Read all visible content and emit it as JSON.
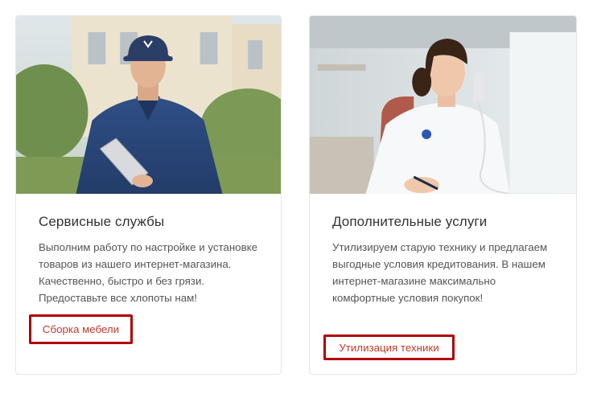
{
  "cards": [
    {
      "image": "worker-with-laptop-photo",
      "title": "Сервисные службы",
      "description": "Выполним работу по настройке и установке товаров из нашего интернет-магазина. Качественно, быстро и без грязи. Предоставьте все хлопоты нам!",
      "link": "Сборка мебели"
    },
    {
      "image": "operator-on-phone-photo",
      "title": "Дополнительные услуги",
      "description": "Утилизируем старую технику и предлагаем выгодные условия кредитования. В нашем интернет-магазине максимально комфортные условия покупок!",
      "link": "Утилизация техники"
    }
  ],
  "colors": {
    "link": "#c0392b",
    "highlight_border": "#b00000",
    "card_border": "#e6e6e6"
  }
}
